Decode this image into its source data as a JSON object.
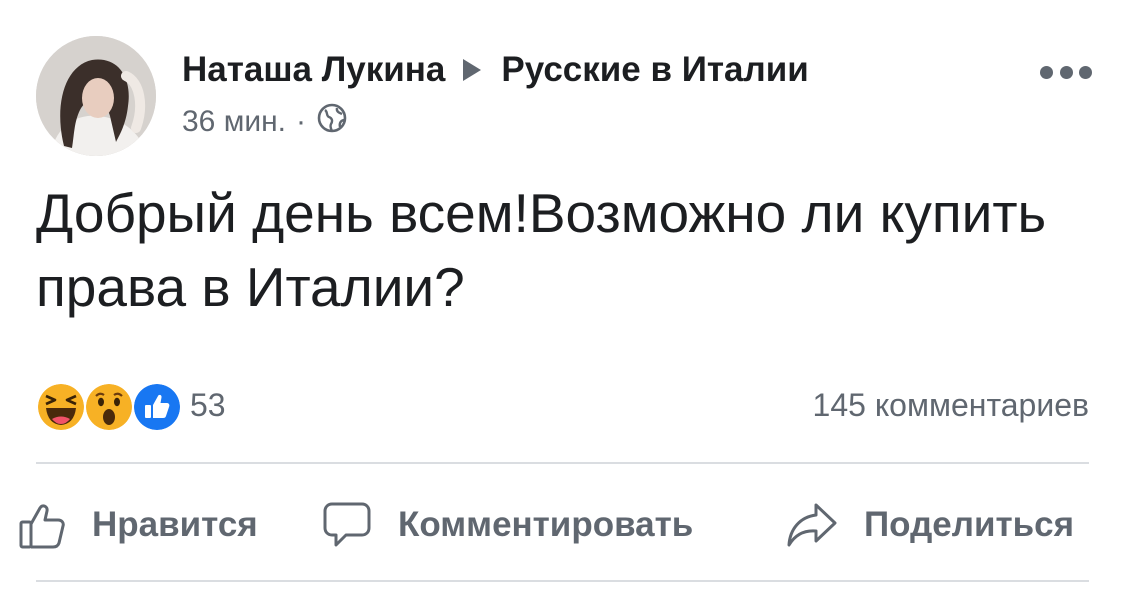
{
  "post": {
    "author": "Наташа Лукина",
    "group": "Русские в Италии",
    "time": "36 мин.",
    "separator": "·",
    "audience_icon": "globe-icon",
    "text": "Добрый день всем!Возможно ли купить права в Италии?"
  },
  "stats": {
    "reaction_icons": [
      "haha-icon",
      "wow-icon",
      "like-icon"
    ],
    "reactions_count": "53",
    "comments": "145 комментариев"
  },
  "actions": {
    "like_label": "Нравится",
    "comment_label": "Комментировать",
    "share_label": "Поделиться"
  },
  "colors": {
    "text": "#1c1e21",
    "secondary": "#606770",
    "divider": "#dadde1",
    "like_blue": "#1877f2",
    "reaction_yellow": "#f7b125"
  }
}
